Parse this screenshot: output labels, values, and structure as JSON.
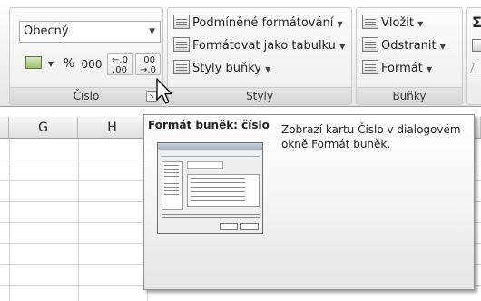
{
  "ribbon": {
    "number_group": {
      "label": "Číslo",
      "format_value": "Obecný",
      "percent": "%",
      "thousands": "000",
      "increase_decimal": "←,0 ,00",
      "decrease_decimal": ",00 →,0"
    },
    "styles_group": {
      "label": "Styly",
      "commands": [
        {
          "label": "Podmíněné formátování",
          "icon": "conditional-formatting-icon"
        },
        {
          "label": "Formátovat jako tabulku",
          "icon": "format-as-table-icon"
        },
        {
          "label": "Styly buňky",
          "icon": "cell-styles-icon"
        }
      ]
    },
    "cells_group": {
      "label": "Buňky",
      "commands": [
        {
          "label": "Vložit",
          "icon": "insert-cells-icon"
        },
        {
          "label": "Odstranit",
          "icon": "delete-cells-icon"
        },
        {
          "label": "Formát",
          "icon": "format-cells-icon"
        }
      ]
    },
    "editing_group": {
      "sum_symbol": "Σ"
    }
  },
  "sheet": {
    "columns": [
      "G",
      "H"
    ]
  },
  "tooltip": {
    "title": "Formát buněk: číslo",
    "description": "Zobrazí kartu Číslo v dialogovém okně Formát buněk."
  }
}
